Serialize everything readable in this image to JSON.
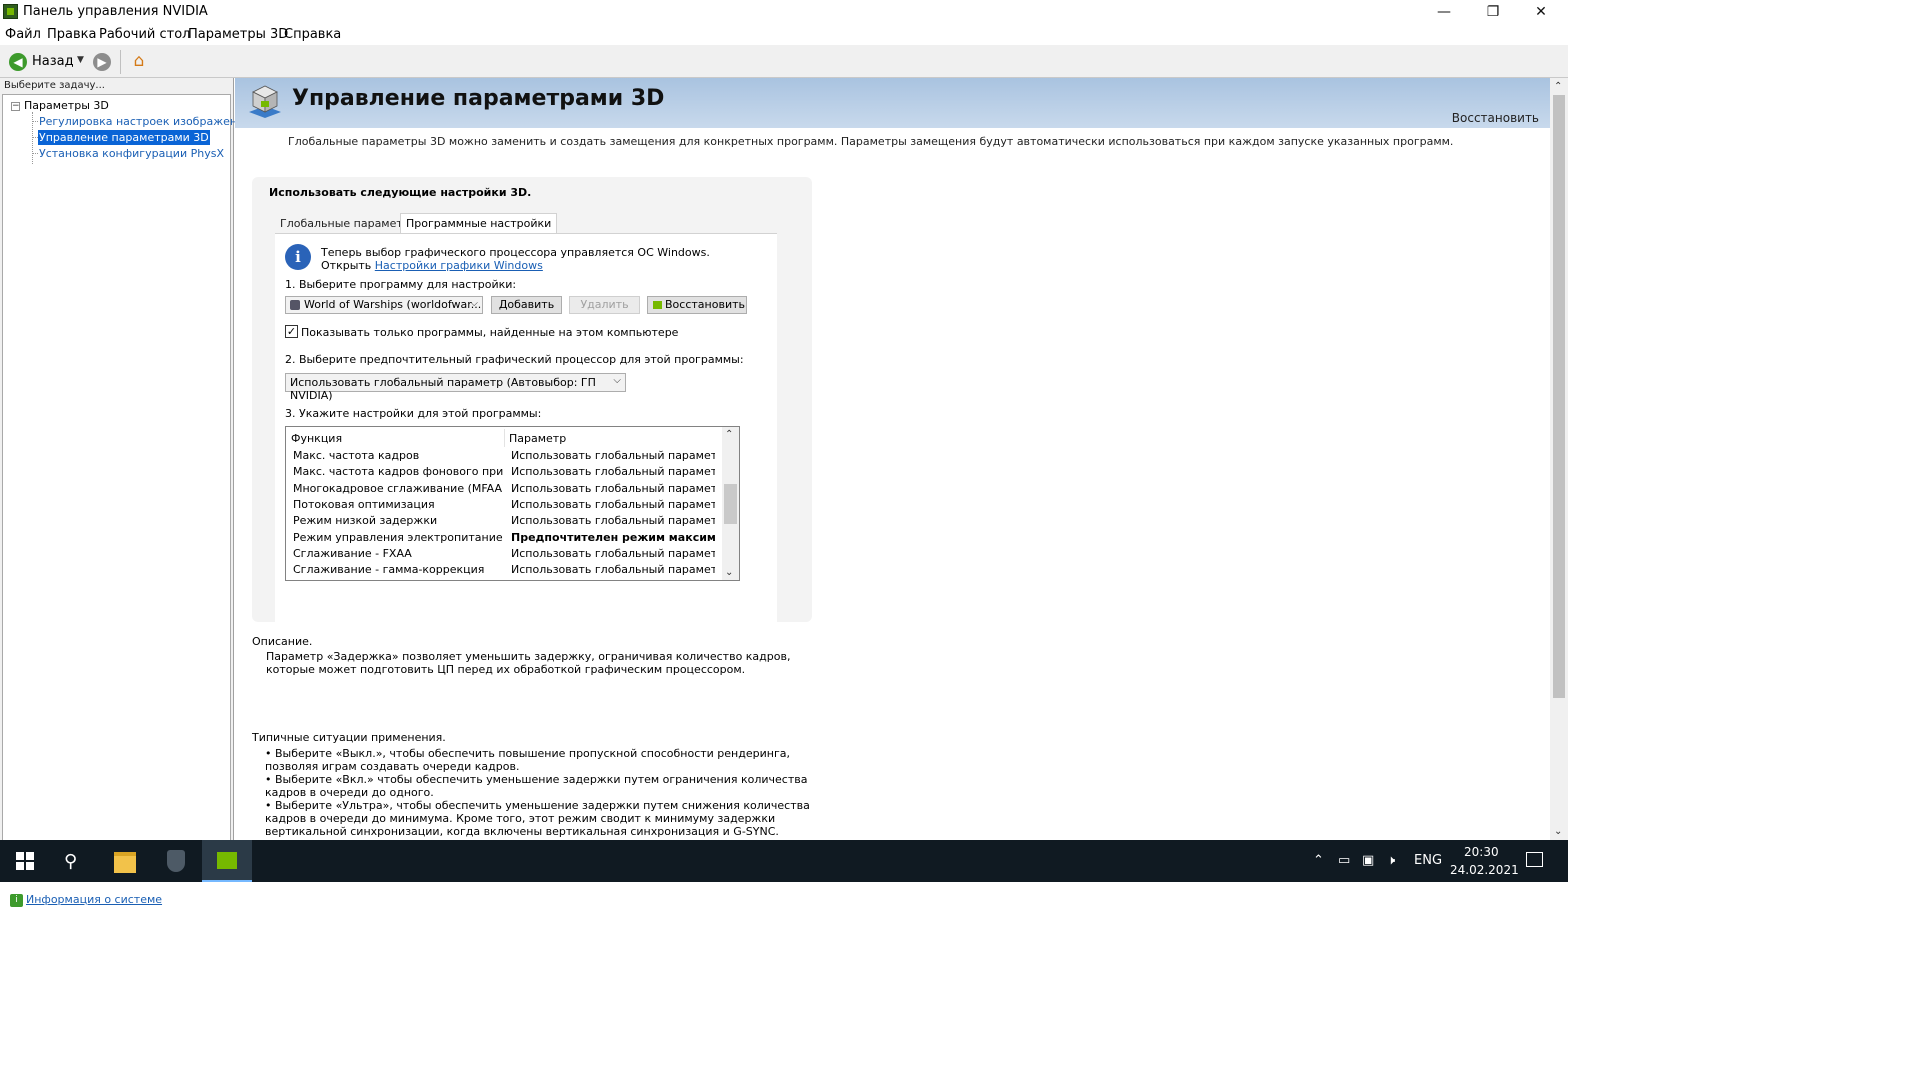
{
  "window": {
    "title": "Панель управления NVIDIA",
    "controls": {
      "minimize": "—",
      "maximize": "❐",
      "close": "✕"
    }
  },
  "menu": [
    "Файл",
    "Правка",
    "Рабочий стол",
    "Параметры 3D",
    "Справка"
  ],
  "toolbar": {
    "back_label": "Назад"
  },
  "sidebar": {
    "header": "Выберите задачу...",
    "root": "Параметры 3D",
    "items": [
      {
        "label": "Регулировка настроек изображения с п",
        "selected": false
      },
      {
        "label": "Управление параметрами 3D",
        "selected": true
      },
      {
        "label": "Установка конфигурации PhysX",
        "selected": false
      }
    ],
    "system_info_link": "Информация о системе"
  },
  "page": {
    "title": "Управление параметрами 3D",
    "restore_link": "Восстановить",
    "intro": "Глобальные параметры 3D можно заменить и создать замещения для конкретных программ. Параметры замещения будут автоматически использоваться при каждом запуске указанных программ.",
    "panel_heading": "Использовать следующие настройки 3D.",
    "tabs": [
      {
        "label": "Глобальные параметры",
        "active": false
      },
      {
        "label": "Программные настройки",
        "active": true
      }
    ],
    "info_line1": "Теперь выбор графического процессора управляется ОС Windows.",
    "info_line2_prefix": "Открыть",
    "info_link": "Настройки графики Windows",
    "step1_label": "1. Выберите программу для настройки:",
    "program_selected": "World of Warships (worldofwar...",
    "buttons": {
      "add": "Добавить",
      "remove": "Удалить",
      "restore": "Восстановить"
    },
    "show_only_label": "Показывать только программы, найденные на этом компьютере",
    "show_only_checked": true,
    "step2_label": "2. Выберите предпочтительный графический процессор для этой программы:",
    "gpu_selected": "Использовать глобальный параметр (Автовыбор: ГП NVIDIA)",
    "step3_label": "3. Укажите настройки для этой программы:",
    "table": {
      "headers": {
        "function": "Функция",
        "parameter": "Параметр"
      },
      "rows": [
        {
          "function": "Макс. частота кадров",
          "parameter": "Использовать глобальный параметр (В...",
          "bold": false
        },
        {
          "function": "Макс. частота кадров фонового прилож...",
          "parameter": "Использовать глобальный параметр (В...",
          "bold": false
        },
        {
          "function": "Многокадровое сглаживание (MFAA)",
          "parameter": "Использовать глобальный параметр (В...",
          "bold": false
        },
        {
          "function": "Потоковая оптимизация",
          "parameter": "Использовать глобальный параметр (А...",
          "bold": false
        },
        {
          "function": "Режим низкой задержки",
          "parameter": "Использовать глобальный параметр (В...",
          "bold": false
        },
        {
          "function": "Режим управления электропитанием",
          "parameter": "Предпочтителен режим максимал...",
          "bold": true
        },
        {
          "function": "Сглаживание - FXAA",
          "parameter": "Использовать глобальный параметр (В...",
          "bold": false
        },
        {
          "function": "Сглаживание - гамма-коррекция",
          "parameter": "Использовать глобальный параметр (В...",
          "bold": false
        }
      ]
    },
    "description_title": "Описание.",
    "description_text": "Параметр «Задержка» позволяет уменьшить задержку, ограничивая количество кадров, которые может подготовить ЦП перед их обработкой графическим процессором.",
    "usage_title": "Типичные ситуации применения.",
    "usage_items": [
      "• Выберите «Выкл.», чтобы обеспечить повышение пропускной способности рендеринга, позволяя играм создавать очереди кадров.",
      "• Выберите «Вкл.» чтобы обеспечить уменьшение задержки путем ограничения количества кадров в очереди до одного.",
      "• Выберите «Ультра», чтобы обеспечить уменьшение задержки путем снижения количества кадров в очереди до минимума. Кроме того, этот режим сводит к минимуму задержки вертикальной синхронизации, когда включены вертикальная синхронизация и G-SYNC."
    ]
  },
  "taskbar": {
    "language": "ENG",
    "time": "20:30",
    "date": "24.02.2021"
  },
  "colors": {
    "accent": "#76b900",
    "header_bg": "#b9cfe7",
    "selection": "#0a64d6",
    "taskbar": "#101a22"
  }
}
